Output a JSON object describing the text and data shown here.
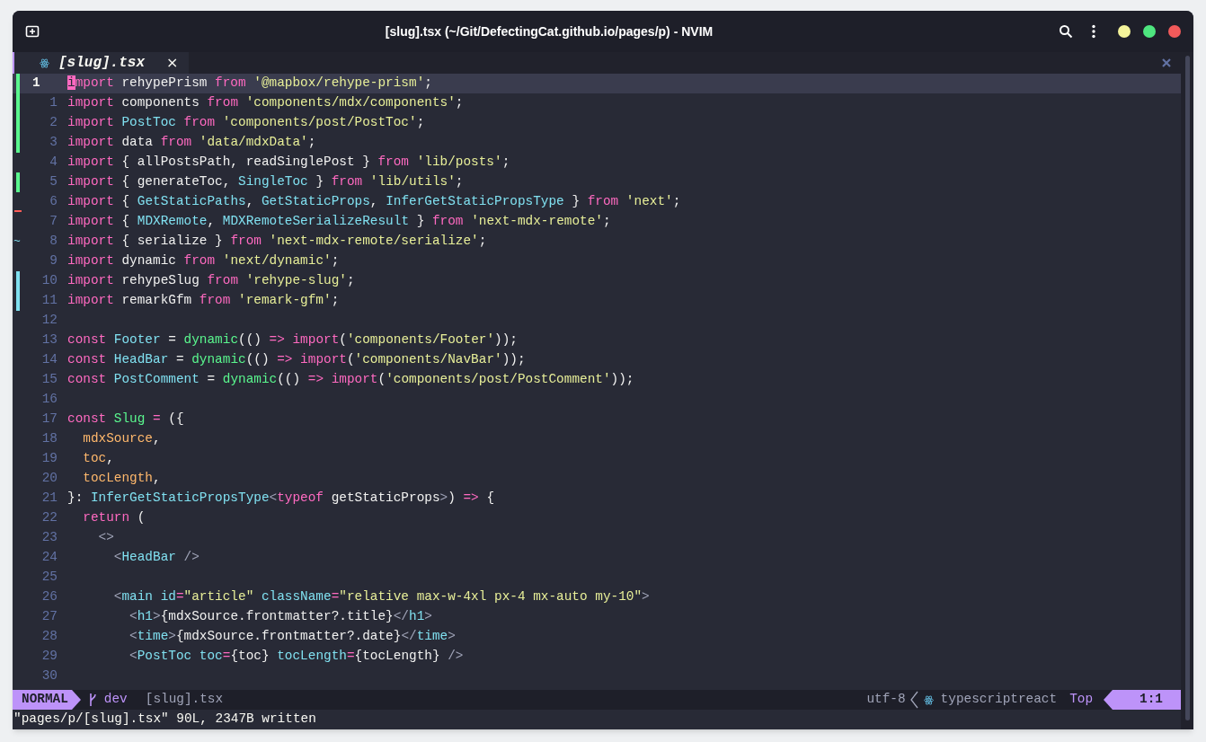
{
  "window": {
    "title": "[slug].tsx (~/Git/DefectingCat.github.io/pages/p) - NVIM"
  },
  "tabs": [
    {
      "label": "[slug].tsx",
      "selected": true,
      "close": "×"
    }
  ],
  "editor": {
    "lines": [
      {
        "number": "1",
        "current": true,
        "git_sign": {
          "kind": "add"
        },
        "code": [
          {
            "kind": "cursor",
            "text": "i"
          },
          {
            "kind": "kw",
            "text": "mport"
          },
          {
            "kind": "txt",
            "text": " rehypePrism "
          },
          {
            "kind": "kw",
            "text": "from "
          },
          {
            "kind": "str",
            "text": "'@mapbox/rehype-prism'"
          },
          {
            "kind": "txt",
            "text": ";"
          }
        ]
      },
      {
        "number": "1",
        "current": false,
        "git_sign": {
          "kind": "add"
        },
        "code": [
          {
            "kind": "kw",
            "text": "import"
          },
          {
            "kind": "txt",
            "text": " components "
          },
          {
            "kind": "kw",
            "text": "from "
          },
          {
            "kind": "str",
            "text": "'components/mdx/components'"
          },
          {
            "kind": "txt",
            "text": ";"
          }
        ]
      },
      {
        "number": "2",
        "current": false,
        "git_sign": {
          "kind": "add"
        },
        "code": [
          {
            "kind": "kw",
            "text": "import "
          },
          {
            "kind": "type",
            "text": "PostToc "
          },
          {
            "kind": "kw",
            "text": "from "
          },
          {
            "kind": "str",
            "text": "'components/post/PostToc'"
          },
          {
            "kind": "txt",
            "text": ";"
          }
        ]
      },
      {
        "number": "3",
        "current": false,
        "git_sign": {
          "kind": "add"
        },
        "code": [
          {
            "kind": "kw",
            "text": "import"
          },
          {
            "kind": "txt",
            "text": " data "
          },
          {
            "kind": "kw",
            "text": "from "
          },
          {
            "kind": "str",
            "text": "'data/mdxData'"
          },
          {
            "kind": "txt",
            "text": ";"
          }
        ]
      },
      {
        "number": "4",
        "current": false,
        "code": [
          {
            "kind": "kw",
            "text": "import"
          },
          {
            "kind": "txt",
            "text": " { allPostsPath, readSinglePost } "
          },
          {
            "kind": "kw",
            "text": "from "
          },
          {
            "kind": "str",
            "text": "'lib/posts'"
          },
          {
            "kind": "txt",
            "text": ";"
          }
        ]
      },
      {
        "number": "5",
        "current": false,
        "git_sign": {
          "kind": "add"
        },
        "code": [
          {
            "kind": "kw",
            "text": "import"
          },
          {
            "kind": "txt",
            "text": " { generateToc, "
          },
          {
            "kind": "type",
            "text": "SingleToc"
          },
          {
            "kind": "txt",
            "text": " } "
          },
          {
            "kind": "kw",
            "text": "from "
          },
          {
            "kind": "str",
            "text": "'lib/utils'"
          },
          {
            "kind": "txt",
            "text": ";"
          }
        ]
      },
      {
        "number": "6",
        "current": false,
        "git_sign": {
          "kind": "delete"
        },
        "code": [
          {
            "kind": "kw",
            "text": "import"
          },
          {
            "kind": "txt",
            "text": " { "
          },
          {
            "kind": "type",
            "text": "GetStaticPaths"
          },
          {
            "kind": "txt",
            "text": ", "
          },
          {
            "kind": "type",
            "text": "GetStaticProps"
          },
          {
            "kind": "txt",
            "text": ", "
          },
          {
            "kind": "type",
            "text": "InferGetStaticPropsType"
          },
          {
            "kind": "txt",
            "text": " } "
          },
          {
            "kind": "kw",
            "text": "from "
          },
          {
            "kind": "str",
            "text": "'next'"
          },
          {
            "kind": "txt",
            "text": ";"
          }
        ]
      },
      {
        "number": "7",
        "current": false,
        "code": [
          {
            "kind": "kw",
            "text": "import"
          },
          {
            "kind": "txt",
            "text": " { "
          },
          {
            "kind": "type",
            "text": "MDXRemote"
          },
          {
            "kind": "txt",
            "text": ", "
          },
          {
            "kind": "type",
            "text": "MDXRemoteSerializeResult"
          },
          {
            "kind": "txt",
            "text": " } "
          },
          {
            "kind": "kw",
            "text": "from "
          },
          {
            "kind": "str",
            "text": "'next-mdx-remote'"
          },
          {
            "kind": "txt",
            "text": ";"
          }
        ]
      },
      {
        "number": "8",
        "current": false,
        "git_sign": {
          "kind": "changedelete",
          "text": "~"
        },
        "code": [
          {
            "kind": "kw",
            "text": "import"
          },
          {
            "kind": "txt",
            "text": " { serialize } "
          },
          {
            "kind": "kw",
            "text": "from "
          },
          {
            "kind": "str",
            "text": "'next-mdx-remote/serialize'"
          },
          {
            "kind": "txt",
            "text": ";"
          }
        ]
      },
      {
        "number": "9",
        "current": false,
        "code": [
          {
            "kind": "kw",
            "text": "import"
          },
          {
            "kind": "txt",
            "text": " dynamic "
          },
          {
            "kind": "kw",
            "text": "from "
          },
          {
            "kind": "str",
            "text": "'next/dynamic'"
          },
          {
            "kind": "txt",
            "text": ";"
          }
        ]
      },
      {
        "number": "10",
        "current": false,
        "git_sign": {
          "kind": "change"
        },
        "code": [
          {
            "kind": "kw",
            "text": "import"
          },
          {
            "kind": "txt",
            "text": " rehypeSlug "
          },
          {
            "kind": "kw",
            "text": "from "
          },
          {
            "kind": "str",
            "text": "'rehype-slug'"
          },
          {
            "kind": "txt",
            "text": ";"
          }
        ]
      },
      {
        "number": "11",
        "current": false,
        "git_sign": {
          "kind": "change"
        },
        "code": [
          {
            "kind": "kw",
            "text": "import"
          },
          {
            "kind": "txt",
            "text": " remarkGfm "
          },
          {
            "kind": "kw",
            "text": "from "
          },
          {
            "kind": "str",
            "text": "'remark-gfm'"
          },
          {
            "kind": "txt",
            "text": ";"
          }
        ]
      },
      {
        "number": "12",
        "current": false
      },
      {
        "number": "13",
        "current": false,
        "code": [
          {
            "kind": "kw",
            "text": "const "
          },
          {
            "kind": "type",
            "text": "Footer"
          },
          {
            "kind": "txt",
            "text": " = "
          },
          {
            "kind": "fn",
            "text": "dynamic"
          },
          {
            "kind": "txt",
            "text": "(() "
          },
          {
            "kind": "kw",
            "text": "=> import"
          },
          {
            "kind": "txt",
            "text": "("
          },
          {
            "kind": "str",
            "text": "'components/Footer'"
          },
          {
            "kind": "txt",
            "text": "));"
          }
        ]
      },
      {
        "number": "14",
        "current": false,
        "code": [
          {
            "kind": "kw",
            "text": "const "
          },
          {
            "kind": "type",
            "text": "HeadBar"
          },
          {
            "kind": "txt",
            "text": " = "
          },
          {
            "kind": "fn",
            "text": "dynamic"
          },
          {
            "kind": "txt",
            "text": "(() "
          },
          {
            "kind": "kw",
            "text": "=> import"
          },
          {
            "kind": "txt",
            "text": "("
          },
          {
            "kind": "str",
            "text": "'components/NavBar'"
          },
          {
            "kind": "txt",
            "text": "));"
          }
        ]
      },
      {
        "number": "15",
        "current": false,
        "code": [
          {
            "kind": "kw",
            "text": "const "
          },
          {
            "kind": "type",
            "text": "PostComment"
          },
          {
            "kind": "txt",
            "text": " = "
          },
          {
            "kind": "fn",
            "text": "dynamic"
          },
          {
            "kind": "txt",
            "text": "(() "
          },
          {
            "kind": "kw",
            "text": "=> import"
          },
          {
            "kind": "txt",
            "text": "("
          },
          {
            "kind": "str",
            "text": "'components/post/PostComment'"
          },
          {
            "kind": "txt",
            "text": "));"
          }
        ]
      },
      {
        "number": "16",
        "current": false
      },
      {
        "number": "17",
        "current": false,
        "code": [
          {
            "kind": "kw",
            "text": "const "
          },
          {
            "kind": "fn",
            "text": "Slug "
          },
          {
            "kind": "kw",
            "text": "="
          },
          {
            "kind": "txt",
            "text": " ({"
          }
        ]
      },
      {
        "number": "18",
        "current": false,
        "code": [
          {
            "kind": "param",
            "text": "  mdxSource"
          },
          {
            "kind": "txt",
            "text": ","
          }
        ]
      },
      {
        "number": "19",
        "current": false,
        "code": [
          {
            "kind": "param",
            "text": "  toc"
          },
          {
            "kind": "txt",
            "text": ","
          }
        ]
      },
      {
        "number": "20",
        "current": false,
        "code": [
          {
            "kind": "param",
            "text": "  tocLength"
          },
          {
            "kind": "txt",
            "text": ","
          }
        ]
      },
      {
        "number": "21",
        "current": false,
        "code": [
          {
            "kind": "txt",
            "text": "}: "
          },
          {
            "kind": "type",
            "text": "InferGetStaticPropsType"
          },
          {
            "kind": "tag",
            "text": "<"
          },
          {
            "kind": "kw",
            "text": "typeof"
          },
          {
            "kind": "txt",
            "text": " getStaticProps"
          },
          {
            "kind": "tag",
            "text": ">"
          },
          {
            "kind": "txt",
            "text": ") "
          },
          {
            "kind": "kw",
            "text": "=>"
          },
          {
            "kind": "txt",
            "text": " {"
          }
        ]
      },
      {
        "number": "22",
        "current": false,
        "code": [
          {
            "kind": "kw",
            "text": "  return"
          },
          {
            "kind": "txt",
            "text": " ("
          }
        ]
      },
      {
        "number": "23",
        "current": false,
        "code": [
          {
            "kind": "tag",
            "text": "    <>"
          }
        ]
      },
      {
        "number": "24",
        "current": false,
        "code": [
          {
            "kind": "tag",
            "text": "      <"
          },
          {
            "kind": "type",
            "text": "HeadBar"
          },
          {
            "kind": "tag",
            "text": " />"
          }
        ]
      },
      {
        "number": "25",
        "current": false
      },
      {
        "number": "26",
        "current": false,
        "code": [
          {
            "kind": "tag",
            "text": "      <"
          },
          {
            "kind": "type",
            "text": "main id"
          },
          {
            "kind": "kw",
            "text": "="
          },
          {
            "kind": "str",
            "text": "\"article\""
          },
          {
            "kind": "type",
            "text": " className"
          },
          {
            "kind": "kw",
            "text": "="
          },
          {
            "kind": "str",
            "text": "\"relative max-w-4xl px-4 mx-auto my-10\""
          },
          {
            "kind": "tag",
            "text": ">"
          }
        ]
      },
      {
        "number": "27",
        "current": false,
        "code": [
          {
            "kind": "tag",
            "text": "        <"
          },
          {
            "kind": "type",
            "text": "h1"
          },
          {
            "kind": "tag",
            "text": ">"
          },
          {
            "kind": "txt",
            "text": "{mdxSource.frontmatter?.title}"
          },
          {
            "kind": "tag",
            "text": "</"
          },
          {
            "kind": "type",
            "text": "h1"
          },
          {
            "kind": "tag",
            "text": ">"
          }
        ]
      },
      {
        "number": "28",
        "current": false,
        "code": [
          {
            "kind": "tag",
            "text": "        <"
          },
          {
            "kind": "type",
            "text": "time"
          },
          {
            "kind": "tag",
            "text": ">"
          },
          {
            "kind": "txt",
            "text": "{mdxSource.frontmatter?.date}"
          },
          {
            "kind": "tag",
            "text": "</"
          },
          {
            "kind": "type",
            "text": "time"
          },
          {
            "kind": "tag",
            "text": ">"
          }
        ]
      },
      {
        "number": "29",
        "current": false,
        "code": [
          {
            "kind": "tag",
            "text": "        <"
          },
          {
            "kind": "type",
            "text": "PostToc toc"
          },
          {
            "kind": "kw",
            "text": "="
          },
          {
            "kind": "txt",
            "text": "{toc} "
          },
          {
            "kind": "type",
            "text": "tocLength"
          },
          {
            "kind": "kw",
            "text": "="
          },
          {
            "kind": "txt",
            "text": "{tocLength}"
          },
          {
            "kind": "tag",
            "text": " />"
          }
        ]
      },
      {
        "number": "30",
        "current": false
      }
    ]
  },
  "status_bar": {
    "mode": "NORMAL",
    "branch": "dev",
    "file": "[slug].tsx",
    "encoding": "utf-8",
    "filetype": "typescriptreact",
    "position": "Top",
    "cursor": "1:1"
  },
  "command_line": "\"pages/p/[slug].tsx\" 90L, 2347B written"
}
